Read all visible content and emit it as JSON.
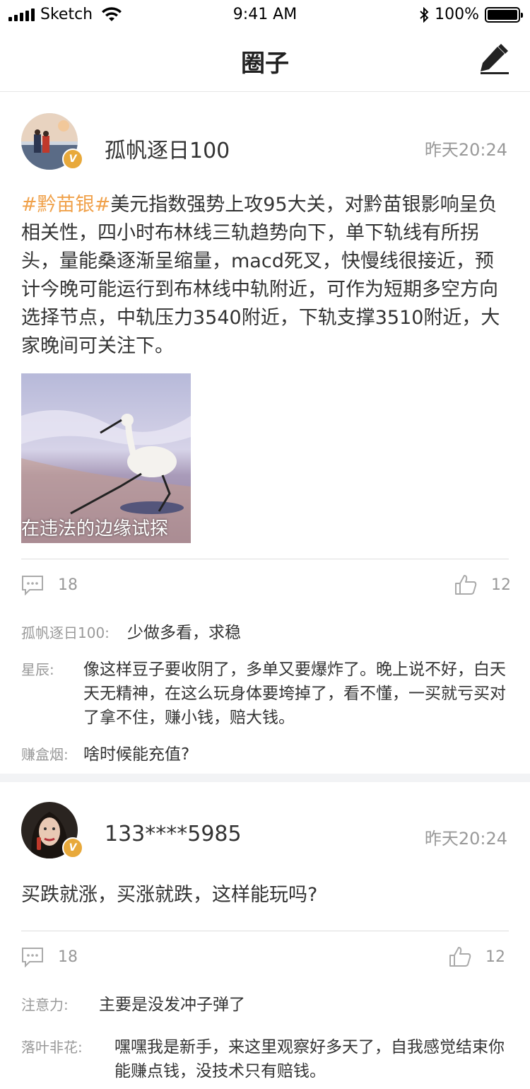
{
  "status_bar": {
    "carrier": "Sketch",
    "time": "9:41 AM",
    "battery": "100%"
  },
  "nav": {
    "title": "圈子"
  },
  "posts": [
    {
      "username": "孤帆逐日100",
      "time": "昨天20:24",
      "hashtag": "#黔苗银#",
      "content": "美元指数强势上攻95大关，对黔苗银影响呈负相关性，四小时布林线三轨趋势向下，单下轨线有所拐头，量能桑逐渐呈缩量，macd死叉，快慢线很接近，预计今晚可能运行到布林线中轨附近，可作为短期多空方向选择节点，中轨压力3540附近，下轨支撑3510附近，大家晚间可关注下。",
      "image_caption": "在违法的边缘试探",
      "comments_count": "18",
      "likes_count": "12",
      "comments": [
        {
          "name": "孤帆逐日100:",
          "text": "少做多看，求稳"
        },
        {
          "name": "星辰:",
          "text": "像这样豆子要收阴了，多单又要爆炸了。晚上说不好，白天天无精神，在这么玩身体要垮掉了，看不懂，一买就亏买对了拿不住，赚小钱，赔大钱。"
        },
        {
          "name": "赚盒烟:",
          "text": "啥时候能充值?"
        }
      ]
    },
    {
      "username": "133****5985",
      "time": "昨天20:24",
      "content": "买跌就涨，买涨就跌，这样能玩吗?",
      "comments_count": "18",
      "likes_count": "12",
      "comments": [
        {
          "name": "注意力:",
          "text": "主要是没发冲子弹了"
        },
        {
          "name": "落叶非花:",
          "text": "嘿嘿我是新手，来这里观察好多天了，自我感觉结束你能赚点钱，没技术只有赔钱。"
        }
      ]
    }
  ],
  "colors": {
    "hashtag": "#f0a14a",
    "badge": "#e8a93b",
    "muted": "#999999",
    "divider": "#dedede"
  }
}
